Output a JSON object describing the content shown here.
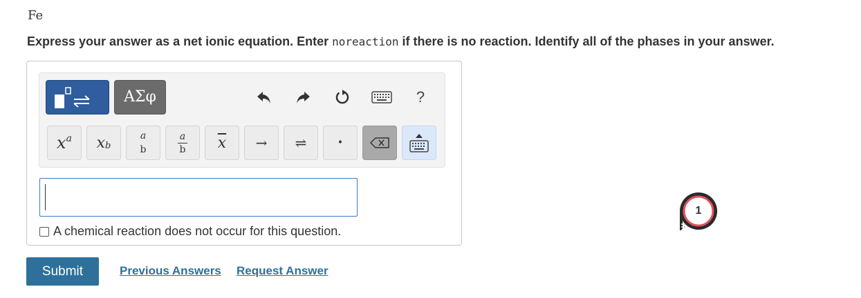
{
  "formula": "Fe",
  "instruction": {
    "part1": "Express your answer as a net ionic equation. Enter ",
    "code": "noreaction",
    "part2": " if there is no reaction. Identify all of the phases in your answer."
  },
  "toolbar": {
    "greek_label": "ΑΣφ",
    "help_label": "?"
  },
  "keys": {
    "superscript_base": "x",
    "superscript_exp": "a",
    "subscript_base": "x",
    "subscript_sub": "b",
    "frac_top": "a",
    "frac_bottom": "b",
    "frac2_top": "a",
    "frac2_bottom": "b",
    "overline_x": "x",
    "arrow": "→",
    "equilibrium": "⇌",
    "dot": "•"
  },
  "no_reaction_label": "A chemical reaction does not occur for this question.",
  "submit_label": "Submit",
  "previous_answers_label": "Previous Answers",
  "request_answer_label": "Request Answer",
  "badge_count": "1",
  "colors": {
    "accent": "#2e7099",
    "template_button": "#2f5d9e",
    "badge_ring": "#e0525f"
  }
}
